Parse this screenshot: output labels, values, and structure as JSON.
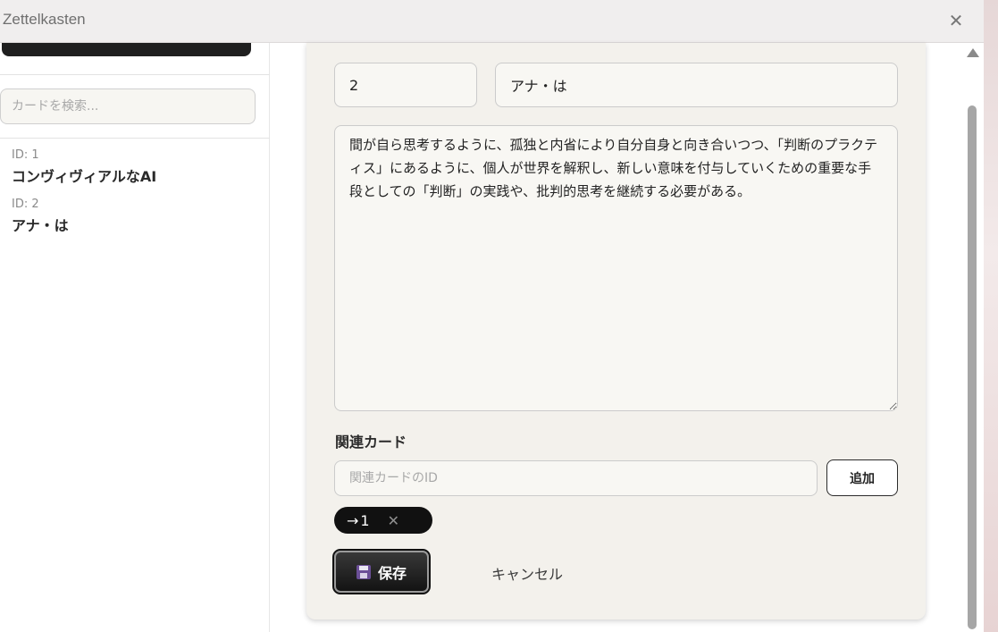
{
  "window": {
    "title": "Zettelkasten",
    "close_symbol": "✕"
  },
  "sidebar": {
    "search_placeholder": "カードを検索...",
    "cards": [
      {
        "id_label": "ID: 1",
        "title": "コンヴィヴィアルなAI"
      },
      {
        "id_label": "ID: 2",
        "title": "アナ・は"
      }
    ]
  },
  "editor": {
    "id_value": "2",
    "title_value": "アナ・は",
    "body_value": "間が自ら思考するように、孤独と内省により自分自身と向き合いつつ、「判断のプラクティス」にあるように、個人が世界を解釈し、新しい意味を付与していくための重要な手段としての「判断」の実践や、批判的思考を継続する必要がある。",
    "related_heading": "関連カード",
    "related_placeholder": "関連カードのID",
    "add_label": "追加",
    "related_chips": [
      {
        "arrow": "→",
        "label": "1",
        "remove_symbol": "✕"
      }
    ],
    "save_label": "保存",
    "cancel_label": "キャンセル"
  },
  "icons": {
    "close": "close-icon",
    "arrow": "arrow-right-icon",
    "remove": "x-icon",
    "save": "floppy-disk-icon",
    "scroll_up": "scroll-up-arrow-icon"
  },
  "colors": {
    "panel_background": "#f3f1ec",
    "titlebar_background": "#f0eeee",
    "primary_button": "#111111",
    "save_icon": "#6b4f97"
  }
}
